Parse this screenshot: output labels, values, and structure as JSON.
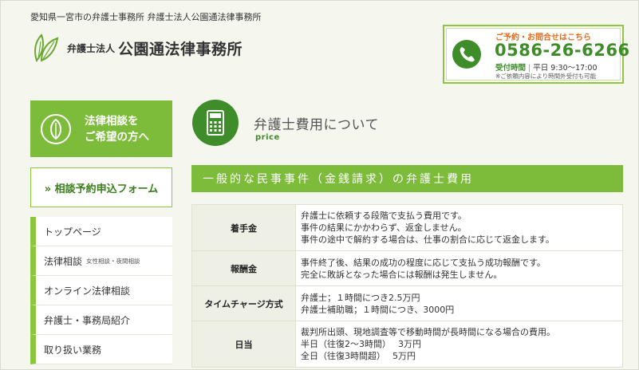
{
  "header": {
    "tagline": "愛知県一宮市の弁護士事務所 弁護士法人公園通法律事務所",
    "logo_small": "弁護士法人",
    "logo_big": "公園通法律事務所"
  },
  "contact": {
    "caption": "ご予約・お問合せはこちら",
    "phone": "0586-26-6266",
    "hours_label": "受付時間",
    "hours_value": "平日 9:30～17:00",
    "note": "※ご依頼内容により時間外受付も可能"
  },
  "sidebar": {
    "consult_line1": "法律相談を",
    "consult_line2": "ご希望の方へ",
    "reserve_label": "» 相談予約申込フォーム",
    "nav": [
      {
        "label": "トップページ",
        "sub": ""
      },
      {
        "label": "法律相談",
        "sub": "女性相談・夜間相談"
      },
      {
        "label": "オンライン法律相談",
        "sub": ""
      },
      {
        "label": "弁護士・事務局紹介",
        "sub": ""
      },
      {
        "label": "取り扱い業務",
        "sub": ""
      }
    ]
  },
  "main": {
    "title": "弁護士費用について",
    "subtitle": "price",
    "section_title": "一般的な民事事件（金銭請求）の弁護士費用",
    "rows": [
      {
        "label": "着手金",
        "lines": [
          "弁護士に依頼する段階で支払う費用です。",
          "事件の結果にかかわらず、返金しません。",
          "事件の途中で解約する場合は、仕事の割合に応じて返金します。"
        ]
      },
      {
        "label": "報酬金",
        "lines": [
          "事件終了後、結果の成功の程度に応じて支払う成功報酬です。",
          "完全に敗訴となった場合には報酬は発生しません。"
        ]
      },
      {
        "label": "タイムチャージ方式",
        "lines": [
          "弁護士；１時間につき2.5万円",
          "弁護士補助職；１時間につき、3000円"
        ]
      },
      {
        "label": "日当",
        "lines": [
          "裁判所出頭、現地調査等で移動時間が長時間になる場合の費用。",
          "半日（往復2〜3時間）　 3万円",
          "全日（往復3時間超）　 5万円"
        ]
      }
    ]
  },
  "colors": {
    "accent": "#7dbb3a",
    "dark_green": "#3f8c2b",
    "orange": "#e06c1f",
    "background": "#f5f7ee"
  }
}
